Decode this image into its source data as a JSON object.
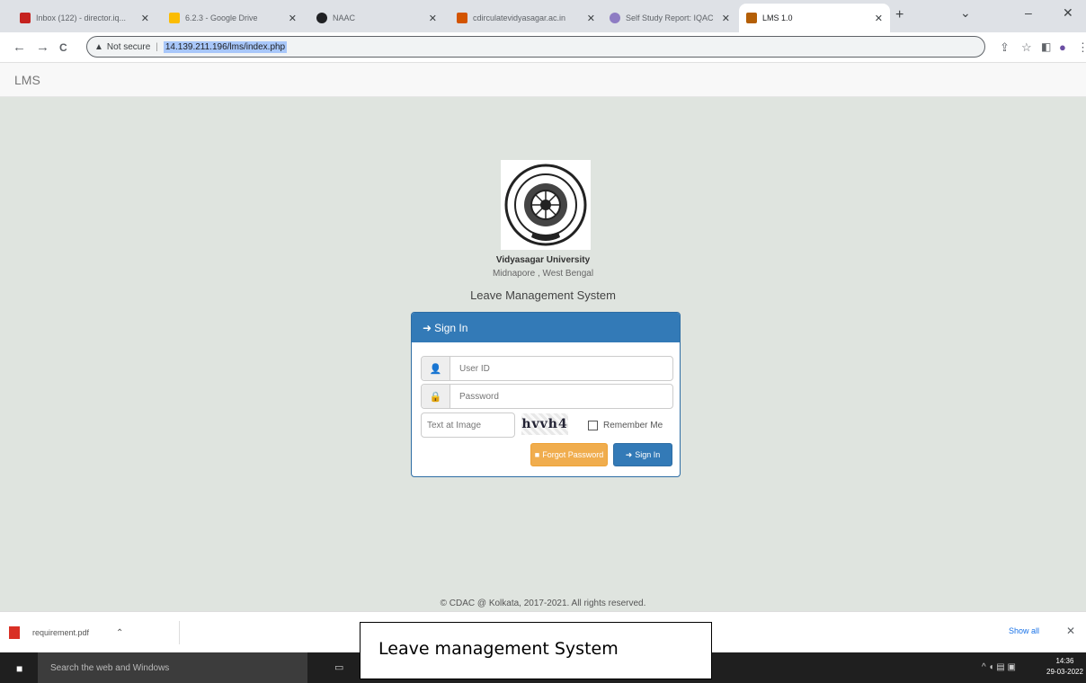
{
  "browser": {
    "tabs": [
      {
        "label": "Inbox (122) - director.iq...",
        "favicon_color": "#c5221f",
        "active": false
      },
      {
        "label": "6.2.3 - Google Drive",
        "favicon_color": "#fbbc04",
        "active": false
      },
      {
        "label": "NAAC",
        "favicon_color": "#202124",
        "active": false
      },
      {
        "label": "cdirculatevidyasagar.ac.in",
        "favicon_color": "#d35400",
        "active": false
      },
      {
        "label": "Self Study Report: IQAC",
        "favicon_color": "#8e7cc3",
        "active": false
      },
      {
        "label": "LMS 1.0",
        "favicon_color": "#b45f06",
        "active": true
      }
    ],
    "new_tab_symbol": "+",
    "window_controls": {
      "dropdown": "⌄",
      "minimize": "–",
      "close": "✕"
    },
    "security_label": "Not secure",
    "url": "14.139.211.196/lms/index.php",
    "nav": {
      "back": "←",
      "forward": "→",
      "reload": "C"
    }
  },
  "page": {
    "brand": "LMS",
    "university_name": "Vidyasagar University",
    "university_location": "Midnapore , West Bengal",
    "system_title": "Leave Management System",
    "signin_panel": {
      "heading": "Sign In",
      "userid_placeholder": "User ID",
      "password_placeholder": "Password",
      "captcha_placeholder": "Text at Image",
      "captcha_text": "hvvh4",
      "remember_label": "Remember Me",
      "forgot_button": "Forgot Password",
      "signin_button": "Sign In"
    },
    "footer": "© CDAC @ Kolkata, 2017-2021. All rights reserved."
  },
  "download_bar": {
    "file_name": "requirement.pdf",
    "show_all": "Show all"
  },
  "caption": "Leave management System",
  "taskbar": {
    "search_placeholder": "Search the web and Windows",
    "time": "14:36",
    "date": "29-03-2022"
  }
}
